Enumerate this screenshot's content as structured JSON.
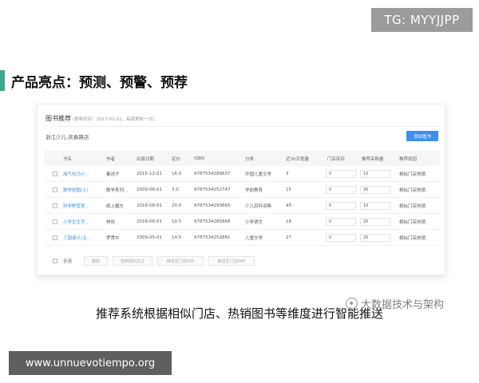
{
  "overlay": {
    "tg_badge": "TG: MYYJJPP",
    "url_badge": "www.unnuevotiempo.org",
    "watermark": "大数据技术与架构"
  },
  "slide": {
    "headline": "产品亮点：预测、预警、预荐",
    "caption": "推荐系统根据相似门店、热销图书等维度进行智能推送",
    "accent_color": "#3ca88f"
  },
  "panel": {
    "title": "图书推荐",
    "subtitle": "(更新时间：2017-01-01，每周更新一次)",
    "store": "浙江少儿-庆春路店",
    "add_button": "添加图书",
    "accent_color": "#3f8fe8",
    "columns": [
      "书名",
      "作者",
      "出版日期",
      "定价",
      "ISBN",
      "分类",
      "近30天销量",
      "门店库存",
      "推荐采购量",
      "推荐原因"
    ],
    "rows": [
      {
        "title": "淘气包马小…",
        "author": "秦池子",
        "date": "2015-12-01",
        "price": "16.0",
        "isbn": "9787534289637",
        "category": "中国儿童文学",
        "sales": "3",
        "stock": "0",
        "qty": "10",
        "reason": "相似门店热销"
      },
      {
        "title": "数学拼图(上)",
        "author": "数学系列…",
        "date": "2009-06-01",
        "price": "3.0",
        "isbn": "9787534252747",
        "category": "学前教育",
        "sales": "15",
        "stock": "0",
        "qty": "30",
        "reason": "相似门店热销"
      },
      {
        "title": "科学野营室…",
        "author": "纸上魔方",
        "date": "2016-08-01",
        "price": "20.0",
        "isbn": "9787534293665",
        "category": "少儿百科词典",
        "sales": "45",
        "stock": "5",
        "qty": "10",
        "reason": "相似门店热销"
      },
      {
        "title": "小学生生字…",
        "author": "林彤",
        "date": "2016-06-01",
        "price": "10.5",
        "isbn": "9787534285868",
        "category": "小学语文",
        "sales": "18",
        "stock": "0",
        "qty": "20",
        "reason": "相似门店热销"
      },
      {
        "title": "三国演义(注…",
        "author": "罗贯中",
        "date": "2009-05-01",
        "price": "14.5",
        "isbn": "9787534253881",
        "category": "儿童文学",
        "sales": "27",
        "stock": "0",
        "qty": "20",
        "reason": "相似门店热销"
      }
    ],
    "footer": {
      "select_all": "全选",
      "delete": "删除",
      "add_follow": "加到我的关注",
      "push_store": "推送至门店ERP",
      "push_all": "推送至门店ERP"
    }
  }
}
